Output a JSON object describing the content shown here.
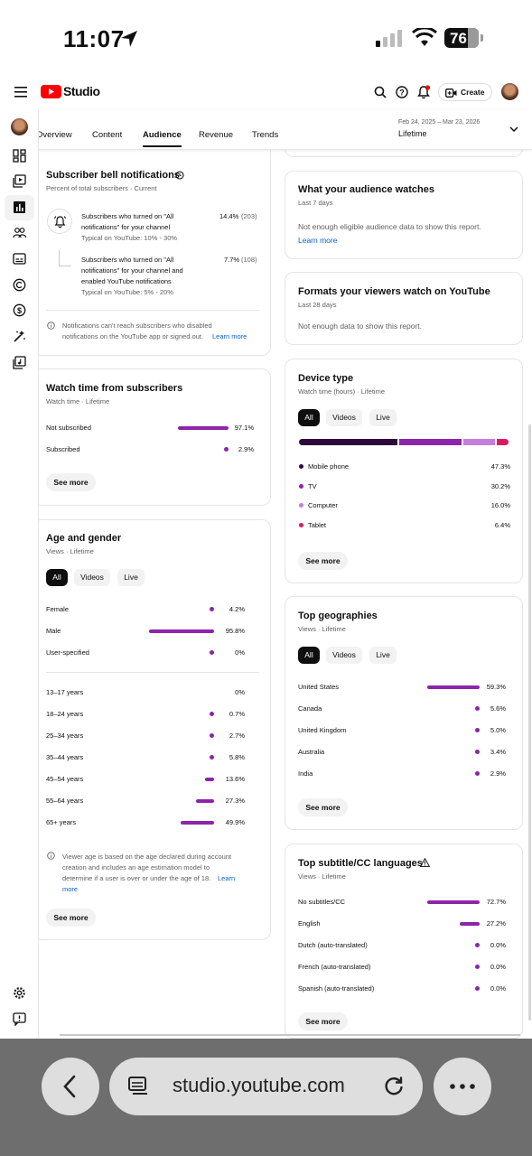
{
  "status": {
    "time": "11:07",
    "battery": "76"
  },
  "topbar": {
    "title": "Studio",
    "create_label": "Create"
  },
  "tabs": [
    {
      "label": "Overview"
    },
    {
      "label": "Content"
    },
    {
      "label": "Audience"
    },
    {
      "label": "Revenue"
    },
    {
      "label": "Trends"
    }
  ],
  "date_range": {
    "dates": "Feb 24, 2025 – Mar 23, 2026",
    "label": "Lifetime"
  },
  "bell": {
    "title": "Subscriber bell notifications",
    "subtitle": "Percent of total subscribers · Current",
    "rows": [
      {
        "l1": "Subscribers who turned on \"All",
        "l2": "notifications\" for your channel",
        "l3": "",
        "typical": "Typical on YouTube: 10% - 30%",
        "pct": "14.4%",
        "count": "(203)"
      },
      {
        "l1": "Subscribers who turned on \"All",
        "l2": "notifications\" for your channel and",
        "l3": "enabled YouTube notifications",
        "typical": "Typical on YouTube: 5% - 20%",
        "pct": "7.7%",
        "count": "(108)"
      }
    ],
    "note1": "Notifications can't reach subscribers who disabled",
    "note2": "notifications on the YouTube app or signed out.",
    "note_link": "Learn more"
  },
  "watchtime": {
    "title": "Watch time from subscribers",
    "subtitle": "Watch time · Lifetime",
    "rows": [
      {
        "label": "Not subscribed",
        "pct": "97.1%",
        "value": 97.1
      },
      {
        "label": "Subscribed",
        "pct": "2.9%",
        "value": 2.9
      }
    ],
    "button": "See more"
  },
  "age_gender": {
    "title": "Age and gender",
    "subtitle": "Views · Lifetime",
    "chips": [
      "All",
      "Videos",
      "Live"
    ],
    "gender": [
      {
        "label": "Female",
        "pct": "4.2%",
        "value": 4.2
      },
      {
        "label": "Male",
        "pct": "95.8%",
        "value": 95.8
      },
      {
        "label": "User-specified",
        "pct": "0%",
        "value": 0.5
      }
    ],
    "ages": [
      {
        "label": "13–17 years",
        "pct": "0%",
        "value": 0
      },
      {
        "label": "18–24 years",
        "pct": "0.7%",
        "value": 0.7
      },
      {
        "label": "25–34 years",
        "pct": "2.7%",
        "value": 2.7
      },
      {
        "label": "35–44 years",
        "pct": "5.8%",
        "value": 5.8
      },
      {
        "label": "45–54 years",
        "pct": "13.6%",
        "value": 13.6
      },
      {
        "label": "55–64 years",
        "pct": "27.3%",
        "value": 27.3
      },
      {
        "label": "65+ years",
        "pct": "49.9%",
        "value": 49.9
      }
    ],
    "note1": "Viewer age is based on the age declared during account",
    "note2": "creation and includes an age estimation model to",
    "note3": "determine if a user is over or under the age of 18.",
    "note_link1": "Learn",
    "note_link2": "more",
    "button": "See more"
  },
  "audience_watches": {
    "title": "What your audience watches",
    "subtitle": "Last 7 days",
    "body": "Not enough eligible audience data to show this report.",
    "link": "Learn more"
  },
  "formats": {
    "title": "Formats your viewers watch on YouTube",
    "subtitle": "Last 28 days",
    "body": "Not enough data to show this report."
  },
  "device": {
    "title": "Device type",
    "subtitle": "Watch time (hours) · Lifetime",
    "chips": [
      "All",
      "Videos",
      "Live"
    ],
    "rows": [
      {
        "label": "Mobile phone",
        "pct": "47.3%",
        "value": 47.3,
        "color": "#2e0a3b"
      },
      {
        "label": "TV",
        "pct": "30.2%",
        "value": 30.2,
        "color": "#8e24aa"
      },
      {
        "label": "Computer",
        "pct": "16.0%",
        "value": 16.0,
        "color": "#c77dde"
      },
      {
        "label": "Tablet",
        "pct": "6.4%",
        "value": 6.4,
        "color": "#d81b60"
      }
    ],
    "button": "See more"
  },
  "geographies": {
    "title": "Top geographies",
    "subtitle": "Views · Lifetime",
    "chips": [
      "All",
      "Videos",
      "Live"
    ],
    "rows": [
      {
        "label": "United States",
        "pct": "59.3%",
        "value": 59.3
      },
      {
        "label": "Canada",
        "pct": "5.6%",
        "value": 5.6
      },
      {
        "label": "United Kingdom",
        "pct": "5.0%",
        "value": 5.0
      },
      {
        "label": "Australia",
        "pct": "3.4%",
        "value": 3.4
      },
      {
        "label": "India",
        "pct": "2.9%",
        "value": 2.9
      }
    ],
    "button": "See more"
  },
  "subtitles": {
    "title": "Top subtitle/CC languages",
    "subtitle": "Views · Lifetime",
    "rows": [
      {
        "label": "No subtitles/CC",
        "pct": "72.7%",
        "value": 72.7
      },
      {
        "label": "English",
        "pct": "27.2%",
        "value": 27.2
      },
      {
        "label": "Dutch (auto-translated)",
        "pct": "0.0%",
        "value": 0
      },
      {
        "label": "French (auto-translated)",
        "pct": "0.0%",
        "value": 0
      },
      {
        "label": "Spanish (auto-translated)",
        "pct": "0.0%",
        "value": 0
      }
    ],
    "button": "See more"
  },
  "browser": {
    "url": "studio.youtube.com"
  },
  "colors": {
    "accent": "#8e24aa",
    "brand": "#ff0000",
    "link": "#065fd4"
  }
}
